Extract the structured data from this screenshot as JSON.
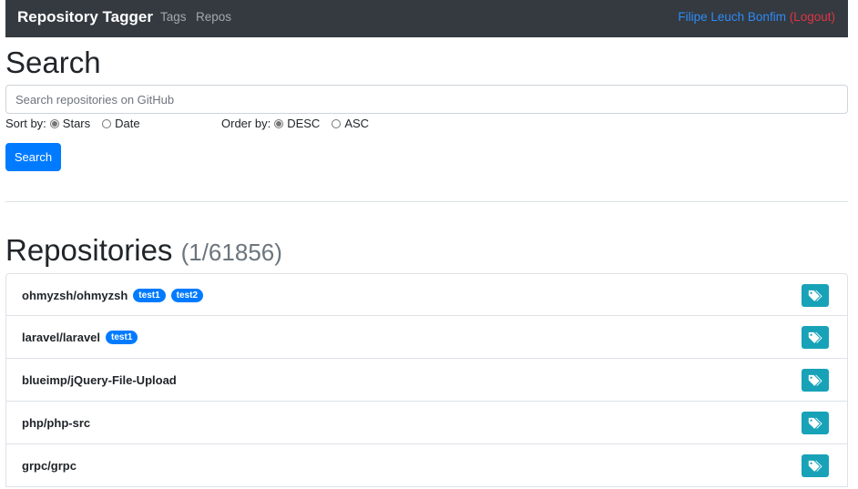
{
  "navbar": {
    "brand": "Repository Tagger",
    "links": [
      "Tags",
      "Repos"
    ],
    "user_name": "Filipe Leuch Bonfim",
    "logout": "(Logout)"
  },
  "search": {
    "title": "Search",
    "placeholder": "Search repositories on GitHub",
    "sort_label": "Sort by:",
    "sort_options": [
      {
        "label": "Stars",
        "checked": true
      },
      {
        "label": "Date",
        "checked": false
      }
    ],
    "order_label": "Order by:",
    "order_options": [
      {
        "label": "DESC",
        "checked": true
      },
      {
        "label": "ASC",
        "checked": false
      }
    ],
    "button": "Search"
  },
  "repositories": {
    "title": "Repositories",
    "counter": "(1/61856)",
    "items": [
      {
        "name": "ohmyzsh/ohmyzsh",
        "tags": [
          "test1",
          "test2"
        ]
      },
      {
        "name": "laravel/laravel",
        "tags": [
          "test1"
        ]
      },
      {
        "name": "blueimp/jQuery-File-Upload",
        "tags": []
      },
      {
        "name": "php/php-src",
        "tags": []
      },
      {
        "name": "grpc/grpc",
        "tags": []
      }
    ]
  },
  "colors": {
    "navbar_bg": "#343a40",
    "primary": "#007bff",
    "tag_button": "#17a2b8",
    "logout": "#dc3545"
  },
  "icons": {
    "tag_button_icon": "tags-icon"
  }
}
